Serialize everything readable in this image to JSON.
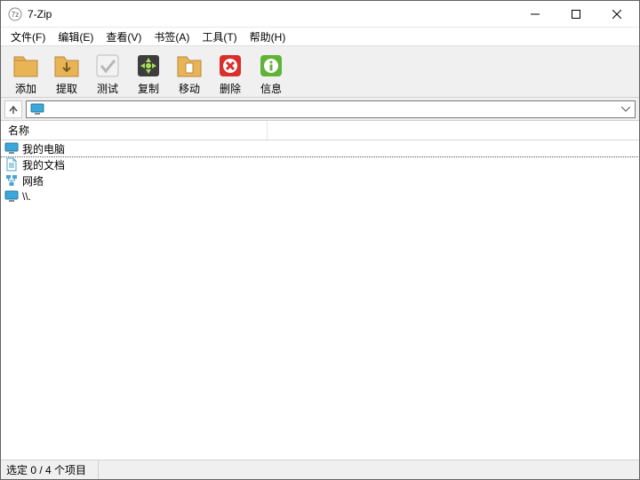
{
  "window": {
    "title": "7-Zip"
  },
  "menu": {
    "file": "文件(F)",
    "edit": "编辑(E)",
    "view": "查看(V)",
    "bookmarks": "书签(A)",
    "tools": "工具(T)",
    "help": "帮助(H)"
  },
  "toolbar": {
    "add": "添加",
    "extract": "提取",
    "test": "测试",
    "copy": "复制",
    "move": "移动",
    "delete": "删除",
    "info": "信息"
  },
  "address": {
    "value": ""
  },
  "columns": {
    "name": "名称"
  },
  "items": [
    {
      "label": "我的电脑",
      "icon": "computer"
    },
    {
      "label": "我的文档",
      "icon": "document"
    },
    {
      "label": "网络",
      "icon": "network"
    },
    {
      "label": "\\\\.",
      "icon": "monitor"
    }
  ],
  "status": {
    "selection": "选定 0 / 4 个项目"
  }
}
